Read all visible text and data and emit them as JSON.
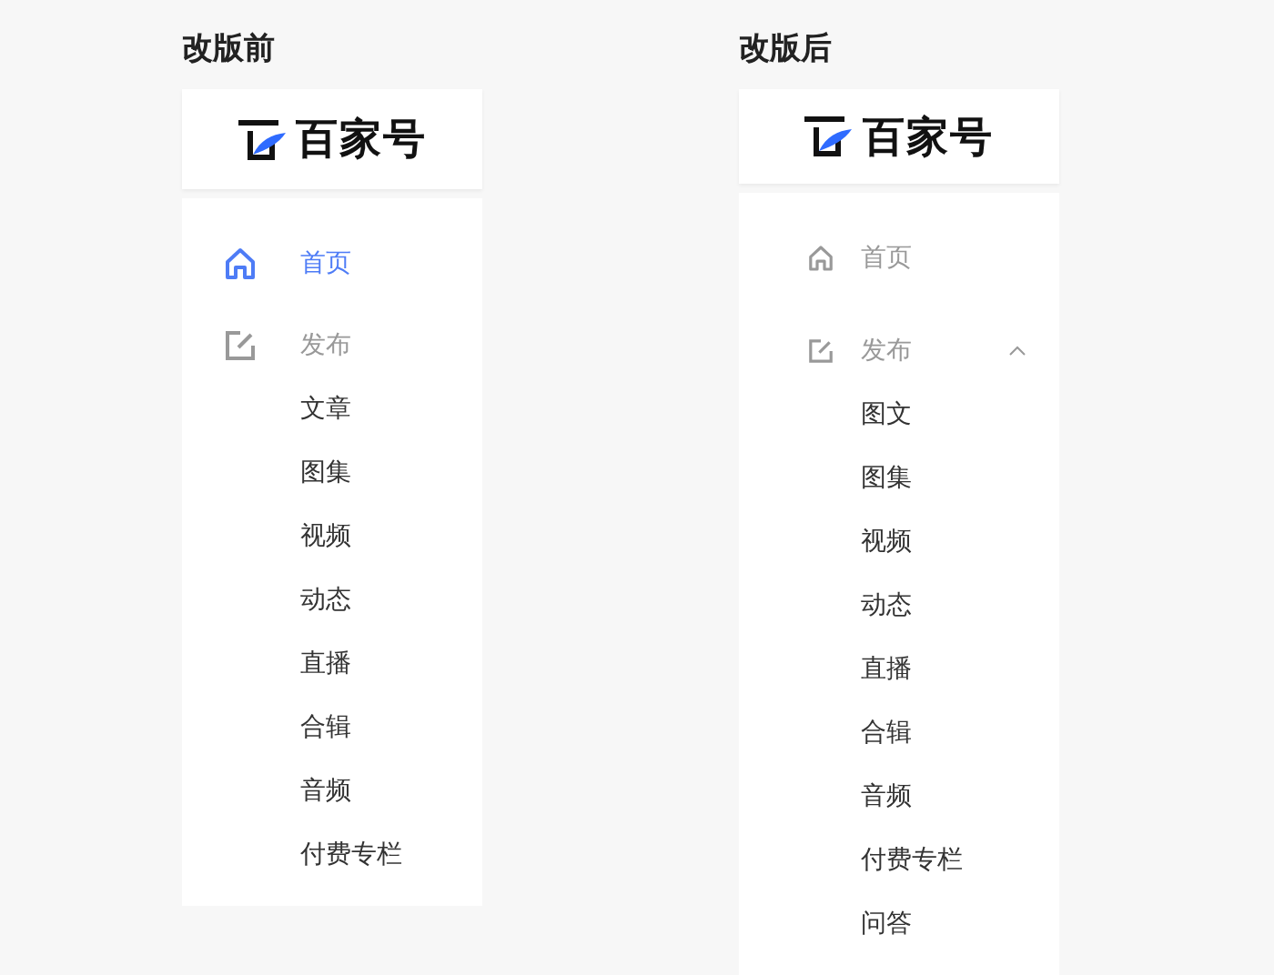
{
  "panels": [
    {
      "kind": "classic",
      "title": "改版前",
      "logo_text": "百家号",
      "items": [
        {
          "label": "首页",
          "kind": "home",
          "selected": true
        },
        {
          "label": "发布",
          "kind": "edit",
          "selected": false,
          "children": [
            "文章",
            "图集",
            "视频",
            "动态",
            "直播",
            "合辑",
            "音频",
            "付费专栏"
          ]
        }
      ]
    },
    {
      "kind": "revised",
      "title": "改版后",
      "logo_text": "百家号",
      "items": [
        {
          "label": "首页",
          "kind": "home",
          "selected": false
        },
        {
          "label": "发布",
          "kind": "edit",
          "selected": false,
          "expanded": true,
          "children": [
            "图文",
            "图集",
            "视频",
            "动态",
            "直播",
            "合辑",
            "音频",
            "付费专栏",
            "问答"
          ]
        }
      ]
    }
  ]
}
